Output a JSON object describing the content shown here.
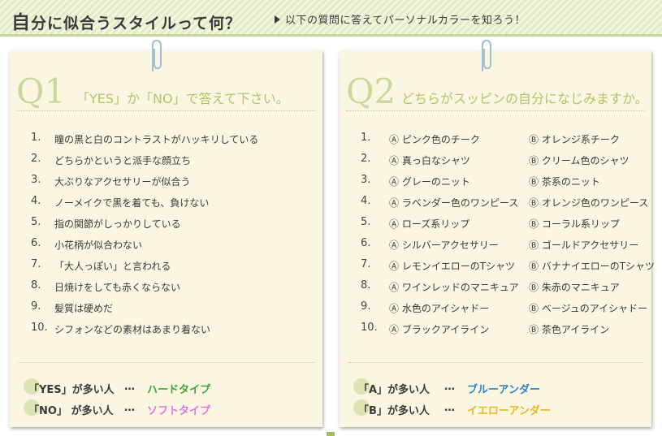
{
  "header": {
    "title_first": "自",
    "title_rest": "分に似合うスタイルって何？",
    "subtitle": "以下の質問に答えてパーソナルカラーを知ろう！"
  },
  "q1": {
    "number": "Q1",
    "question": "「YES」か「NO」で答えて下さい。",
    "items": [
      {
        "n": "1.",
        "text": "瞳の黒と白のコントラストがハッキリしている"
      },
      {
        "n": "2.",
        "text": "どちらかというと派手な顔立ち"
      },
      {
        "n": "3.",
        "text": "大ぶりなアクセサリーが似合う"
      },
      {
        "n": "4.",
        "text": "ノーメイクで黒を着ても、負けない"
      },
      {
        "n": "5.",
        "text": "指の関節がしっかりしている"
      },
      {
        "n": "6.",
        "text": "小花柄が似合わない"
      },
      {
        "n": "7.",
        "text": "「大人っぽい」と言われる"
      },
      {
        "n": "8.",
        "text": "日焼けをしても赤くならない"
      },
      {
        "n": "9.",
        "text": "髪質は硬めだ"
      },
      {
        "n": "10.",
        "text": "シフォンなどの素材はあまり着ない"
      }
    ],
    "results": [
      {
        "label": "「YES」が多い人",
        "dots": "…",
        "type": "ハードタイプ",
        "color": "#3aa53a"
      },
      {
        "label": "「NO」 が多い人",
        "dots": "…",
        "type": "ソフトタイプ",
        "color": "#e074e0"
      }
    ]
  },
  "q2": {
    "number": "Q2",
    "question": "どちらがスッピンの自分になじみますか。",
    "items": [
      {
        "n": "1.",
        "a": "Ⓐ ピンク色のチーク",
        "b": "Ⓑ オレンジ系チーク"
      },
      {
        "n": "2.",
        "a": "Ⓐ 真っ白なシャツ",
        "b": "Ⓑ クリーム色のシャツ"
      },
      {
        "n": "3.",
        "a": "Ⓐ グレーのニット",
        "b": "Ⓑ 茶系のニット"
      },
      {
        "n": "4.",
        "a": "Ⓐ ラベンダー色のワンピース",
        "b": "Ⓑ オレンジ色のワンピース"
      },
      {
        "n": "5.",
        "a": "Ⓐ ローズ系リップ",
        "b": "Ⓑ コーラル系リップ"
      },
      {
        "n": "6.",
        "a": "Ⓐ シルバーアクセサリー",
        "b": "Ⓑ ゴールドアクセサリー"
      },
      {
        "n": "7.",
        "a": "Ⓐ レモンイエローのTシャツ",
        "b": "Ⓑ バナナイエローのTシャツ"
      },
      {
        "n": "8.",
        "a": "Ⓐ ワインレッドのマニキュア",
        "b": "Ⓑ 朱赤のマニキュア"
      },
      {
        "n": "9.",
        "a": "Ⓐ 水色のアイシャドー",
        "b": "Ⓑ ベージュのアイシャドー"
      },
      {
        "n": "10.",
        "a": "Ⓐ ブラックアイライン",
        "b": "Ⓑ 茶色アイライン"
      }
    ],
    "results": [
      {
        "label": "「A」が多い人",
        "dots": "…",
        "type": "ブルーアンダー",
        "color": "#2e80cc"
      },
      {
        "label": "「B」が多い人",
        "dots": "…",
        "type": "イエローアンダー",
        "color": "#e4b826"
      }
    ]
  },
  "colors": {
    "accent_green": "#c9d79a",
    "card_bg": "#fbf6e2",
    "header_stripe": "#e3ecc4"
  }
}
